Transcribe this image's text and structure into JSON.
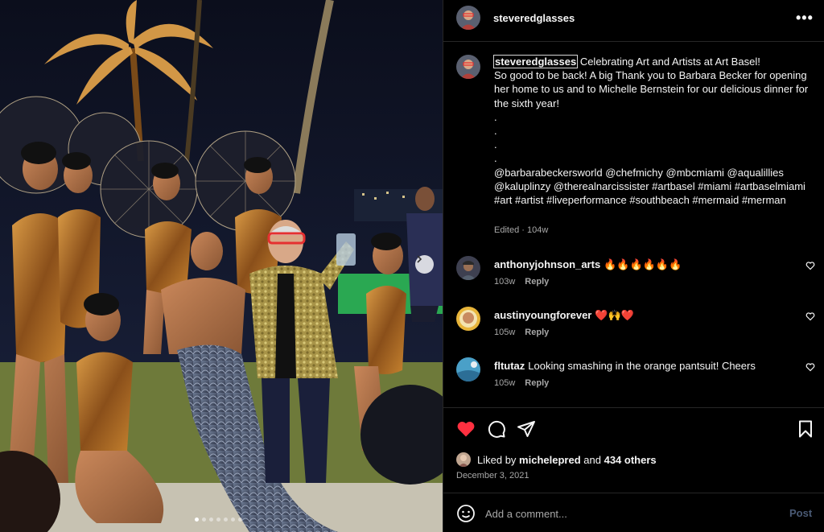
{
  "post": {
    "username": "steveredglasses",
    "more_icon": "more-horizontal-icon",
    "caption": {
      "username": "steveredglasses",
      "text": "Celebrating Art and Artists at Art Basel!\nSo good to be back! A big Thank you to Barbara Becker for opening her home to us and to Michelle Bernstein for our delicious dinner for the sixth year!\n.\n.\n.\n.\n@barbarabeckersworld @chefmichy @mbcmiami @aqualillies @kaluplinzy @therealnarcissister #artbasel #miami #artbaselmiami #art #artist #liveperformance #southbeach #mermaid #merman",
      "meta": "Edited · 104w"
    },
    "comments": [
      {
        "username": "anthonyjohnson_arts",
        "text": "🔥🔥🔥🔥🔥🔥",
        "time": "103w",
        "reply": "Reply"
      },
      {
        "username": "austinyoungforever",
        "text": "❤️🙌❤️",
        "time": "105w",
        "reply": "Reply"
      },
      {
        "username": "fltutaz",
        "text": "Looking smashing in the orange pantsuit! Cheers",
        "time": "105w",
        "reply": "Reply"
      }
    ],
    "likes": {
      "prefix": "Liked by",
      "user": "michelepred",
      "connector": "and",
      "others": "434 others"
    },
    "date": "December 3, 2021",
    "add_comment": {
      "placeholder": "Add a comment...",
      "post_label": "Post"
    },
    "carousel": {
      "count": 7,
      "active_index": 0
    },
    "colors": {
      "like_red": "#ff3040",
      "muted": "#a8a8a8",
      "border": "#262626",
      "post_disabled": "#4a5a75"
    }
  }
}
